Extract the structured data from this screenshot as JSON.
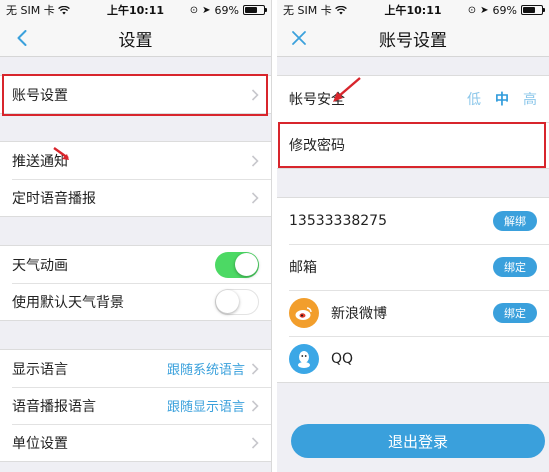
{
  "status_bar": {
    "carrier": "无 SIM 卡",
    "time": "上午10:11",
    "battery": "69%",
    "battery_level": 0.69
  },
  "left_screen": {
    "nav": {
      "title": "设置",
      "back_icon": "chevron-left-icon"
    },
    "groups": [
      {
        "rows": [
          {
            "label": "账号设置"
          }
        ]
      },
      {
        "rows": [
          {
            "label": "推送通知"
          },
          {
            "label": "定时语音播报"
          }
        ]
      },
      {
        "rows": [
          {
            "label": "天气动画",
            "toggle": "on"
          },
          {
            "label": "使用默认天气背景",
            "toggle": "off"
          }
        ]
      },
      {
        "rows": [
          {
            "label": "显示语言",
            "value": "跟随系统语言"
          },
          {
            "label": "语音播报语言",
            "value": "跟随显示语言"
          },
          {
            "label": "单位设置"
          }
        ]
      }
    ]
  },
  "right_screen": {
    "nav": {
      "title": "账号设置",
      "close_icon": "close-icon"
    },
    "security": {
      "label": "帐号安全",
      "levels": [
        "低",
        "中",
        "高"
      ],
      "active_level": "中"
    },
    "change_password": {
      "label": "修改密码"
    },
    "accounts": [
      {
        "label": "13533338275",
        "button": "解绑",
        "icon": ""
      },
      {
        "label": "邮箱",
        "button": "绑定",
        "icon": ""
      },
      {
        "label": "新浪微博",
        "button": "绑定",
        "icon": "weibo-icon"
      },
      {
        "label": "QQ",
        "button": "",
        "icon": "qq-icon"
      }
    ],
    "logout_label": "退出登录"
  },
  "colors": {
    "accent": "#3aa0dc",
    "highlight_box": "#d8252c",
    "toggle_on": "#4cd964",
    "background": "#efeff4"
  }
}
